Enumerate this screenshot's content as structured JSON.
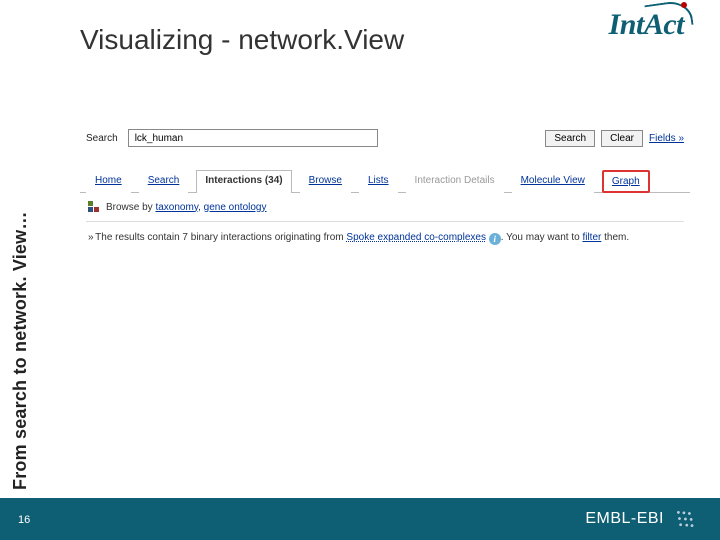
{
  "logo": {
    "text": "IntAct"
  },
  "title": "Visualizing - network.View",
  "sidebar_text": "From search to network. View…",
  "screenshot": {
    "search": {
      "label": "Search",
      "value": "lck_human",
      "search_btn": "Search",
      "clear_btn": "Clear",
      "fields_link": "Fields »"
    },
    "tabs": {
      "home": "Home",
      "search": "Search",
      "interactions": "Interactions (34)",
      "browse": "Browse",
      "lists": "Lists",
      "details": "Interaction Details",
      "molecule": "Molecule View",
      "graph": "Graph"
    },
    "browse_by": {
      "prefix": "Browse by",
      "taxonomy": "taxonomy",
      "sep": ", ",
      "go": "gene ontology"
    },
    "results": {
      "bullet": "»",
      "t1": " The results contain 7 binary interactions originating from ",
      "spoke": "Spoke expanded co-complexes",
      "t2": ". You may want to ",
      "filter": "filter",
      "t3": " them."
    }
  },
  "footer": {
    "slidenum": "16",
    "ebi": "EMBL-EBI"
  }
}
